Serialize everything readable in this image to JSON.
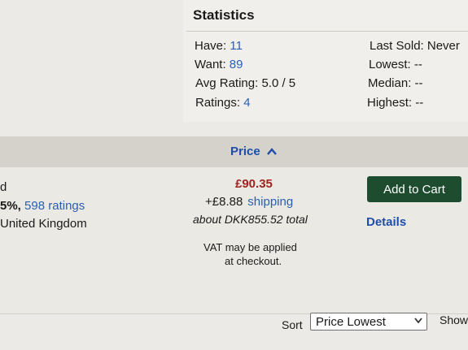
{
  "statistics": {
    "title": "Statistics",
    "have_label": "Have:",
    "have_value": "11",
    "want_label": "Want:",
    "want_value": "89",
    "avg_rating": "Avg Rating: 5.0 / 5",
    "ratings_label": "Ratings:",
    "ratings_value": "4",
    "last_sold": "Last Sold: Never",
    "lowest": "Lowest: --",
    "median": "Median: --",
    "highest": "Highest: --"
  },
  "price_header": {
    "label": "Price",
    "icon": "chevron-up-icon"
  },
  "listing": {
    "seller_partial_top": "d",
    "seller_rating_pct": "5%,",
    "seller_ratings_link": "598 ratings",
    "seller_location": "United Kingdom",
    "price": "£90.35",
    "shipping_cost": "+£8.88",
    "shipping_link": "shipping",
    "total": "about DKK855.52 total",
    "vat_line1": "VAT may be applied",
    "vat_line2": "at checkout.",
    "add_to_cart": "Add to Cart",
    "details": "Details"
  },
  "sort_bar": {
    "sort_label": "Sort",
    "sort_value": "Price Lowest",
    "show_label": "Show"
  },
  "colors": {
    "link": "#2a5fb0",
    "price": "#a1231f",
    "cart_button": "#1d4d2e"
  }
}
